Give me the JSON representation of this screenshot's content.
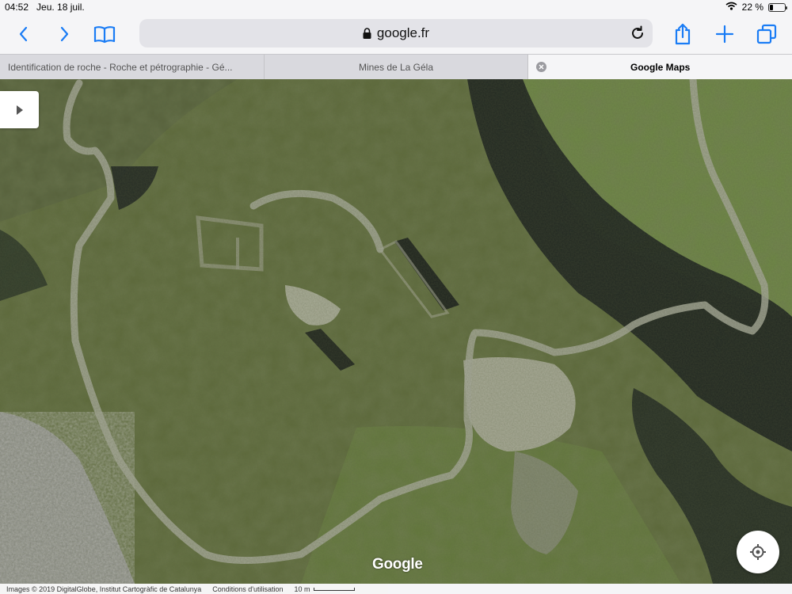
{
  "status": {
    "time": "04:52",
    "date": "Jeu. 18 juil.",
    "battery": "22 %",
    "battery_level": 0.22
  },
  "toolbar": {
    "url": "google.fr"
  },
  "tabs": [
    {
      "label": "Identification de roche - Roche et pétrographie - Gé..."
    },
    {
      "label": "Mines de La Géla"
    },
    {
      "label": "Google Maps"
    }
  ],
  "map": {
    "logo": "Google",
    "attribution": "Images © 2019 DigitalGlobe, Institut Cartogràfic de Catalunya",
    "terms": "Conditions d'utilisation",
    "scale": "10 m"
  },
  "colors": {
    "accent": "#1a7cf5"
  },
  "icons": [
    "back-icon",
    "forward-icon",
    "bookmarks-icon",
    "lock-icon",
    "reload-icon",
    "share-icon",
    "new-tab-icon",
    "tabs-icon",
    "close-icon",
    "play-icon",
    "locate-icon",
    "wifi-icon"
  ]
}
